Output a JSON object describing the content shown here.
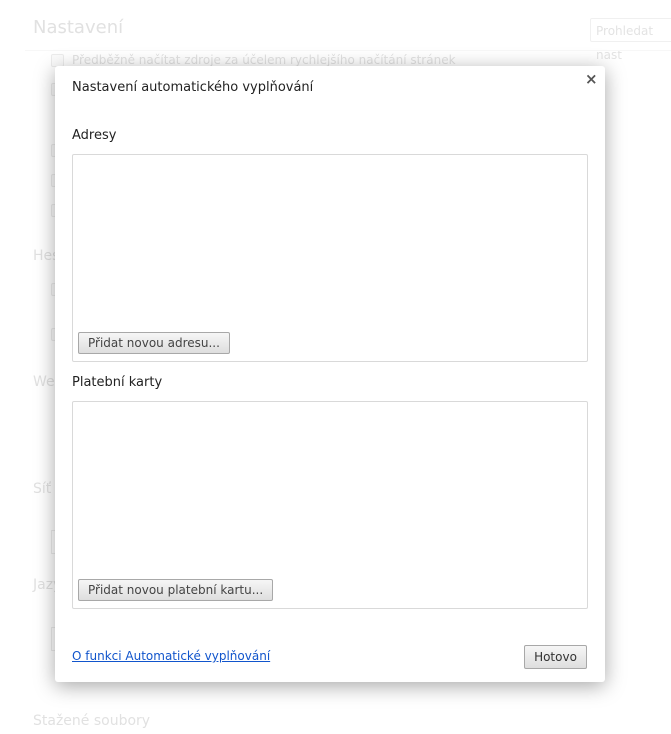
{
  "background": {
    "title": "Nastavení",
    "search_placeholder": "Prohledat nast",
    "prefetch_label": "Předběžně načítat zdroje za účelem rychlejšího načítání stránek",
    "sections": [
      "Hes",
      "Wel",
      "Síť",
      "Jazy"
    ],
    "downloads_heading": "Stažené soubory"
  },
  "dialog": {
    "title": "Nastavení automatického vyplňování",
    "close": "×",
    "addresses_heading": "Adresy",
    "add_address": "Přidat novou adresu...",
    "cards_heading": "Platební karty",
    "add_card": "Přidat novou platební kartu...",
    "help_link": "O funkci Automatické vyplňování",
    "done": "Hotovo"
  }
}
